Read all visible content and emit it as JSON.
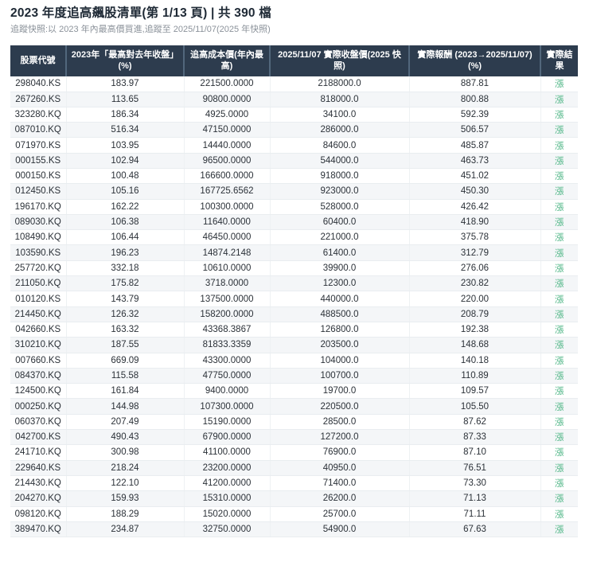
{
  "page": {
    "title": "2023 年度追高飆股清單(第 1/13 頁) | 共 390 檔",
    "subtitle": "追蹤快照:以 2023 年內最高價買進,追蹤至 2025/11/07(2025 年快照)"
  },
  "colors": {
    "header_bg": "#2d3c4e",
    "header_text": "#ffffff",
    "up_green": "#52b788",
    "subtitle_gray": "#8b929a",
    "stripe": "#f4f6f8"
  },
  "table": {
    "columns": [
      "股票代號",
      "2023年「最高對去年收盤」(%)",
      "追高成本價(年內最高)",
      "2025/11/07 實際收盤價(2025 快照)",
      "實際報酬 (2023→2025/11/07) (%)",
      "實際結果"
    ],
    "rows": [
      [
        "298040.KS",
        "183.97",
        "221500.0000",
        "2188000.0",
        "887.81",
        "漲"
      ],
      [
        "267260.KS",
        "113.65",
        "90800.0000",
        "818000.0",
        "800.88",
        "漲"
      ],
      [
        "323280.KQ",
        "186.34",
        "4925.0000",
        "34100.0",
        "592.39",
        "漲"
      ],
      [
        "087010.KQ",
        "516.34",
        "47150.0000",
        "286000.0",
        "506.57",
        "漲"
      ],
      [
        "071970.KS",
        "103.95",
        "14440.0000",
        "84600.0",
        "485.87",
        "漲"
      ],
      [
        "000155.KS",
        "102.94",
        "96500.0000",
        "544000.0",
        "463.73",
        "漲"
      ],
      [
        "000150.KS",
        "100.48",
        "166600.0000",
        "918000.0",
        "451.02",
        "漲"
      ],
      [
        "012450.KS",
        "105.16",
        "167725.6562",
        "923000.0",
        "450.30",
        "漲"
      ],
      [
        "196170.KQ",
        "162.22",
        "100300.0000",
        "528000.0",
        "426.42",
        "漲"
      ],
      [
        "089030.KQ",
        "106.38",
        "11640.0000",
        "60400.0",
        "418.90",
        "漲"
      ],
      [
        "108490.KQ",
        "106.44",
        "46450.0000",
        "221000.0",
        "375.78",
        "漲"
      ],
      [
        "103590.KS",
        "196.23",
        "14874.2148",
        "61400.0",
        "312.79",
        "漲"
      ],
      [
        "257720.KQ",
        "332.18",
        "10610.0000",
        "39900.0",
        "276.06",
        "漲"
      ],
      [
        "211050.KQ",
        "175.82",
        "3718.0000",
        "12300.0",
        "230.82",
        "漲"
      ],
      [
        "010120.KS",
        "143.79",
        "137500.0000",
        "440000.0",
        "220.00",
        "漲"
      ],
      [
        "214450.KQ",
        "126.32",
        "158200.0000",
        "488500.0",
        "208.79",
        "漲"
      ],
      [
        "042660.KS",
        "163.32",
        "43368.3867",
        "126800.0",
        "192.38",
        "漲"
      ],
      [
        "310210.KQ",
        "187.55",
        "81833.3359",
        "203500.0",
        "148.68",
        "漲"
      ],
      [
        "007660.KS",
        "669.09",
        "43300.0000",
        "104000.0",
        "140.18",
        "漲"
      ],
      [
        "084370.KQ",
        "115.58",
        "47750.0000",
        "100700.0",
        "110.89",
        "漲"
      ],
      [
        "124500.KQ",
        "161.84",
        "9400.0000",
        "19700.0",
        "109.57",
        "漲"
      ],
      [
        "000250.KQ",
        "144.98",
        "107300.0000",
        "220500.0",
        "105.50",
        "漲"
      ],
      [
        "060370.KQ",
        "207.49",
        "15190.0000",
        "28500.0",
        "87.62",
        "漲"
      ],
      [
        "042700.KS",
        "490.43",
        "67900.0000",
        "127200.0",
        "87.33",
        "漲"
      ],
      [
        "241710.KQ",
        "300.98",
        "41100.0000",
        "76900.0",
        "87.10",
        "漲"
      ],
      [
        "229640.KS",
        "218.24",
        "23200.0000",
        "40950.0",
        "76.51",
        "漲"
      ],
      [
        "214430.KQ",
        "122.10",
        "41200.0000",
        "71400.0",
        "73.30",
        "漲"
      ],
      [
        "204270.KQ",
        "159.93",
        "15310.0000",
        "26200.0",
        "71.13",
        "漲"
      ],
      [
        "098120.KQ",
        "188.29",
        "15020.0000",
        "25700.0",
        "71.11",
        "漲"
      ],
      [
        "389470.KQ",
        "234.87",
        "32750.0000",
        "54900.0",
        "67.63",
        "漲"
      ]
    ]
  }
}
